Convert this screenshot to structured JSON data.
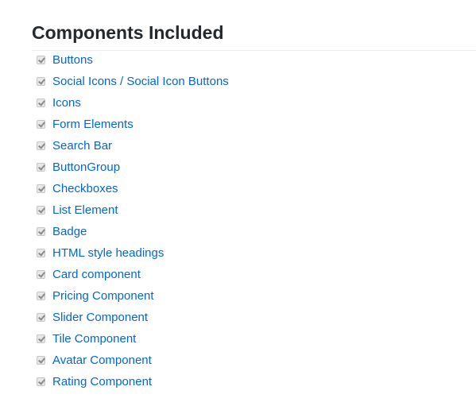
{
  "heading": "Components Included",
  "colors": {
    "link": "#0366d6",
    "heading": "#24292e"
  },
  "items": [
    {
      "label": "Buttons",
      "checked": true
    },
    {
      "label": "Social Icons / Social Icon Buttons",
      "checked": true
    },
    {
      "label": "Icons",
      "checked": true
    },
    {
      "label": "Form Elements",
      "checked": true
    },
    {
      "label": "Search Bar",
      "checked": true
    },
    {
      "label": "ButtonGroup",
      "checked": true
    },
    {
      "label": "Checkboxes",
      "checked": true
    },
    {
      "label": "List Element",
      "checked": true
    },
    {
      "label": "Badge",
      "checked": true
    },
    {
      "label": "HTML style headings",
      "checked": true
    },
    {
      "label": "Card component",
      "checked": true
    },
    {
      "label": "Pricing Component",
      "checked": true
    },
    {
      "label": "Slider Component",
      "checked": true
    },
    {
      "label": "Tile Component",
      "checked": true
    },
    {
      "label": "Avatar Component",
      "checked": true
    },
    {
      "label": "Rating Component",
      "checked": true
    }
  ]
}
